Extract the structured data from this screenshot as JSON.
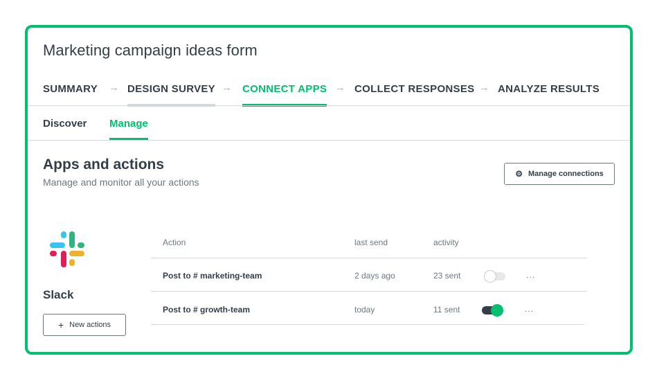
{
  "survey": {
    "title": "Marketing campaign ideas form"
  },
  "steps": [
    {
      "label": "SUMMARY",
      "state": "default"
    },
    {
      "label": "DESIGN SURVEY",
      "state": "visited"
    },
    {
      "label": "CONNECT APPS",
      "state": "active"
    },
    {
      "label": "COLLECT RESPONSES",
      "state": "default"
    },
    {
      "label": "ANALYZE RESULTS",
      "state": "default"
    }
  ],
  "step_arrow": "→",
  "subtabs": [
    {
      "label": "Discover",
      "active": false
    },
    {
      "label": "Manage",
      "active": true
    }
  ],
  "section": {
    "title": "Apps and actions",
    "subtitle": "Manage and monitor all your actions",
    "manage_connections_label": "Manage connections"
  },
  "app": {
    "name": "Slack",
    "new_actions_label": "New actions",
    "logo_colors": [
      "#36c5f0",
      "#2eb67d",
      "#ecb22e",
      "#e01e5a"
    ]
  },
  "table": {
    "headers": [
      "Action",
      "last send",
      "activity"
    ],
    "rows": [
      {
        "action": "Post to # marketing-team",
        "last_send": "2 days ago",
        "activity": "23 sent",
        "enabled": false,
        "more": "..."
      },
      {
        "action": "Post to # growth-team",
        "last_send": "today",
        "activity": "11 sent",
        "enabled": true,
        "more": "..."
      }
    ]
  },
  "colors": {
    "accent": "#00bf6f",
    "text": "#333e48",
    "muted": "#6b787f",
    "border": "#d5d8da"
  }
}
